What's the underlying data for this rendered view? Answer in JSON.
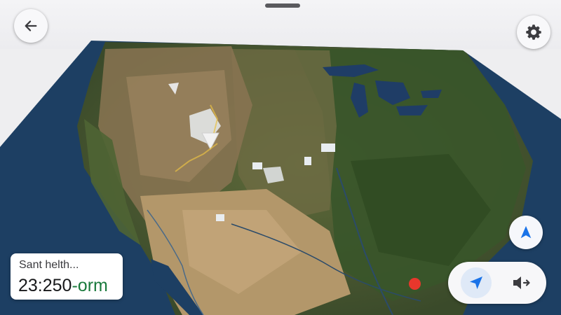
{
  "header": {
    "back_icon": "arrow-left-icon",
    "settings_icon": "gear-icon"
  },
  "map": {
    "style": "satellite-terrain-3d",
    "destination_marker_color": "#e8372c"
  },
  "eta_card": {
    "subtitle": "Sant helth...",
    "time": "23:250",
    "unit": "-orm",
    "unit_color": "#1a7a3c"
  },
  "controls": {
    "compass_icon": "navigation-arrow-icon",
    "recenter_icon": "location-arrow-icon",
    "sound_icon": "speaker-icon",
    "accent_color": "#1a73e8"
  }
}
